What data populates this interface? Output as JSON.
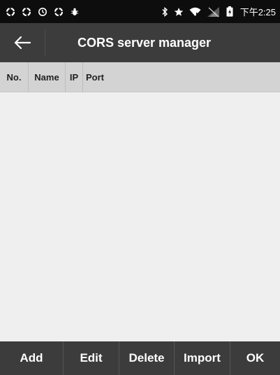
{
  "status_bar": {
    "time": "下午2:25",
    "left_icons": [
      "sync-icon",
      "sync-icon",
      "clock-icon",
      "sync-icon",
      "bug-icon"
    ],
    "right_icons": [
      "bluetooth-icon",
      "star-icon",
      "wifi-icon",
      "no-signal-icon",
      "battery-icon"
    ]
  },
  "header": {
    "title": "CORS server manager",
    "back_icon": "arrow-left-icon"
  },
  "table": {
    "columns": [
      "No.",
      "Name",
      "IP",
      "Port"
    ],
    "rows": []
  },
  "toolbar": {
    "buttons": [
      "Add",
      "Edit",
      "Delete",
      "Import",
      "OK"
    ]
  },
  "colors": {
    "title_bar": "#3c3c3c",
    "status_bar": "#0d0d0d",
    "table_header": "#d3d3d3",
    "background": "#efefef",
    "toolbar": "#3c3c3c"
  }
}
